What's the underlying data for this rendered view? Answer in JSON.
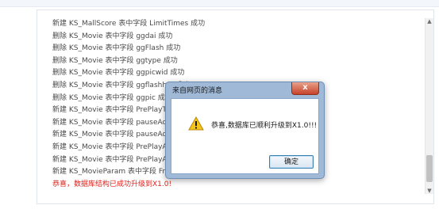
{
  "log": {
    "lines": [
      "新建 KS_MallScore 表中字段 LimitTimes 成功",
      "删除 KS_Movie 表中字段 ggdai 成功",
      "删除 KS_Movie 表中字段 ggFlash 成功",
      "删除 KS_Movie 表中字段 ggtype 成功",
      "删除 KS_Movie 表中字段 ggpicwid 成功",
      "删除 KS_Movie 表中字段 ggflashhei 成功",
      "删除 KS_Movie 表中字段 ggpic 成功",
      "新建 KS_Movie 表中字段 PrePlayTime 成功",
      "新建 KS_Movie 表中字段 pauseAdPic 成功",
      "新建 KS_Movie 表中字段 pauseAdLink 成功",
      "新建 KS_Movie 表中字段 PrePlayAdPic 成功",
      "新建 KS_Movie 表中字段 PrePlayAdLink 成功",
      "新建 KS_MovieParam 表中字段 FreeAdPic 成功"
    ],
    "success_message": "恭喜，数据库结构已成功升级到X1.0!",
    "success_color": "#e0201b"
  },
  "dialog": {
    "title": "来自网页的消息",
    "close_label": "x",
    "message": "恭喜,数据库已顺利升级到X1.0!!!",
    "ok_label": "确定",
    "icon": "warning-icon"
  }
}
